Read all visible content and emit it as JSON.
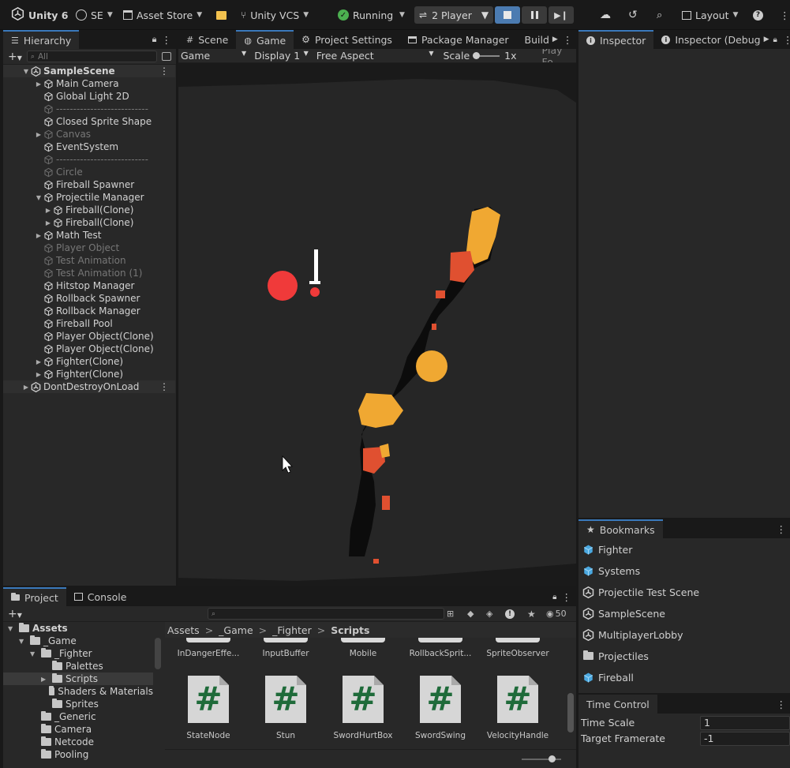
{
  "toolbar": {
    "app_name": "Unity 6",
    "account": "SE",
    "asset_store": "Asset Store",
    "vcs": "Unity VCS",
    "status": "Running",
    "player_count": "2 Player",
    "layout": "Layout"
  },
  "hierarchy": {
    "tab": "Hierarchy",
    "search_placeholder": "All",
    "items": [
      {
        "label": "SampleScene",
        "indent": 0,
        "expanded": true,
        "bold": true,
        "scene": true
      },
      {
        "label": "Main Camera",
        "indent": 1,
        "expander": true
      },
      {
        "label": "Global Light 2D",
        "indent": 1
      },
      {
        "label": "---------------------------",
        "indent": 1,
        "dim": true
      },
      {
        "label": "Closed Sprite Shape",
        "indent": 1
      },
      {
        "label": "Canvas",
        "indent": 1,
        "dim": true,
        "expander": true
      },
      {
        "label": "EventSystem",
        "indent": 1
      },
      {
        "label": "---------------------------",
        "indent": 1,
        "dim": true
      },
      {
        "label": "Circle",
        "indent": 1,
        "dim": true
      },
      {
        "label": "Fireball Spawner",
        "indent": 1
      },
      {
        "label": "Projectile Manager",
        "indent": 1,
        "expanded": true
      },
      {
        "label": "Fireball(Clone)",
        "indent": 2,
        "expander": true
      },
      {
        "label": "Fireball(Clone)",
        "indent": 2,
        "expander": true
      },
      {
        "label": "Math Test",
        "indent": 1,
        "expander": true
      },
      {
        "label": "Player Object",
        "indent": 1,
        "dim": true
      },
      {
        "label": "Test Animation",
        "indent": 1,
        "dim": true
      },
      {
        "label": "Test Animation (1)",
        "indent": 1,
        "dim": true
      },
      {
        "label": "Hitstop Manager",
        "indent": 1
      },
      {
        "label": "Rollback Spawner",
        "indent": 1
      },
      {
        "label": "Rollback Manager",
        "indent": 1
      },
      {
        "label": "Fireball Pool",
        "indent": 1
      },
      {
        "label": "Player Object(Clone)",
        "indent": 1
      },
      {
        "label": "Player Object(Clone)",
        "indent": 1
      },
      {
        "label": "Fighter(Clone)",
        "indent": 1,
        "expander": true
      },
      {
        "label": "Fighter(Clone)",
        "indent": 1,
        "expander": true
      },
      {
        "label": "DontDestroyOnLoad",
        "indent": 0,
        "scene": true,
        "expander": true
      }
    ]
  },
  "center_tabs": {
    "scene": "Scene",
    "game": "Game",
    "project_settings": "Project Settings",
    "package_manager": "Package Manager",
    "build": "Build"
  },
  "game_toolbar": {
    "view": "Game",
    "display": "Display 1",
    "aspect": "Free Aspect",
    "scale_label": "Scale",
    "scale_value": "1x",
    "play_focused": "Play Fo"
  },
  "inspector": {
    "tab1": "Inspector",
    "tab2": "Inspector (Debug"
  },
  "bookmarks": {
    "title": "Bookmarks",
    "items": [
      {
        "label": "Fighter",
        "icon": "prefab-icon"
      },
      {
        "label": "Systems",
        "icon": "prefab-icon"
      },
      {
        "label": "Projectile Test Scene",
        "icon": "scene-icon"
      },
      {
        "label": "SampleScene",
        "icon": "scene-icon"
      },
      {
        "label": "MultiplayerLobby",
        "icon": "scene-icon"
      },
      {
        "label": "Projectiles",
        "icon": "folder-icon"
      },
      {
        "label": "Fireball",
        "icon": "prefab-icon"
      }
    ]
  },
  "time_control": {
    "title": "Time Control",
    "time_scale_label": "Time Scale",
    "time_scale_value": "1",
    "target_framerate_label": "Target Framerate",
    "target_framerate_value": "-1"
  },
  "project": {
    "tab_project": "Project",
    "tab_console": "Console",
    "hidden_count": "50",
    "tree": [
      {
        "label": "Assets",
        "indent": 0,
        "expanded": true,
        "bold": true
      },
      {
        "label": "_Game",
        "indent": 1,
        "expanded": true
      },
      {
        "label": "_Fighter",
        "indent": 2,
        "expanded": true
      },
      {
        "label": "Palettes",
        "indent": 3
      },
      {
        "label": "Scripts",
        "indent": 3,
        "selected": true,
        "expander": true
      },
      {
        "label": "Shaders & Materials",
        "indent": 3
      },
      {
        "label": "Sprites",
        "indent": 3
      },
      {
        "label": "_Generic",
        "indent": 2
      },
      {
        "label": "Camera",
        "indent": 2
      },
      {
        "label": "Netcode",
        "indent": 2
      },
      {
        "label": "Pooling",
        "indent": 2
      }
    ],
    "breadcrumb": [
      "Assets",
      "_Game",
      "_Fighter",
      "Scripts"
    ],
    "top_row": [
      "InDangerEffe...",
      "InputBuffer",
      "Mobile",
      "RollbackSprit...",
      "SpriteObserver"
    ],
    "scripts": [
      "StateNode",
      "Stun",
      "SwordHurtBox",
      "SwordSwing",
      "VelocityHandle"
    ],
    "script_glyph": "#"
  }
}
